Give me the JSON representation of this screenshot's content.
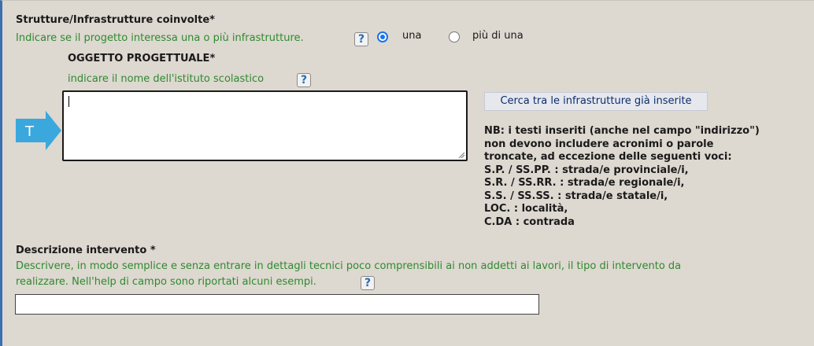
{
  "strutture": {
    "title": "Strutture/Infrastrutture coinvolte*",
    "hint": "Indicare se il progetto interessa una o più infrastrutture.",
    "help_icon": "?",
    "options": [
      {
        "label": "una",
        "selected": true
      },
      {
        "label": "più di una",
        "selected": false
      }
    ]
  },
  "oggetto": {
    "title": "OGGETTO PROGETTUALE*",
    "hint": "indicare il nome dell'istituto scolastico",
    "help_icon": "?",
    "value": "",
    "arrow_letter": "T"
  },
  "cerca_button": "Cerca tra le infrastrutture già inserite",
  "nb_lines": [
    "NB: i testi inseriti (anche nel campo \"indirizzo\")",
    "non devono includere acronimi o parole",
    "troncate, ad eccezione delle seguenti voci:",
    "S.P. / SS.PP. : strada/e provinciale/i,",
    "S.R. / SS.RR. : strada/e regionale/i,",
    "S.S. / SS.SS. : strada/e statale/i,",
    "LOC. : località,",
    "C.DA : contrada"
  ],
  "descrizione": {
    "title": "Descrizione intervento *",
    "hint_line1": "Descrivere, in modo semplice e senza entrare in dettagli tecnici poco comprensibili ai non addetti ai lavori, il tipo di intervento da",
    "hint_line2": "realizzare. Nell'help di campo sono riportati alcuni esempi.",
    "help_icon": "?",
    "value": ""
  },
  "colors": {
    "panel_bg": "#ddd8d0",
    "hint_green": "#2f8a2f",
    "arrow_blue": "#3aa8dd",
    "left_border": "#3a6fb0"
  }
}
